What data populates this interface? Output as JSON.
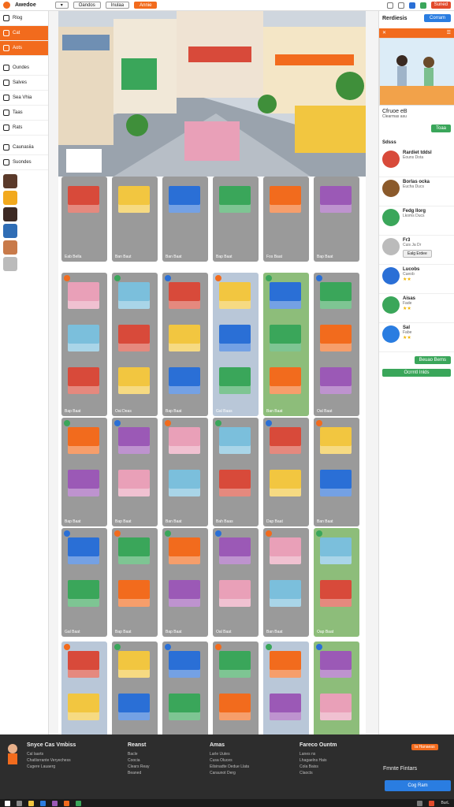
{
  "topbar": {
    "app_name": "Awedoe",
    "tabs": [
      "",
      "Oandos",
      "Inulaa",
      "Annie"
    ],
    "badge": "Suned"
  },
  "leftnav": {
    "items": [
      {
        "label": "Rlog",
        "active": false
      },
      {
        "label": "Cat",
        "active": true
      },
      {
        "label": "Aots",
        "active": true
      },
      {
        "label": "Oundes",
        "active": false
      },
      {
        "label": "Salves",
        "active": false
      },
      {
        "label": "Sea Vhia",
        "active": false
      },
      {
        "label": "Taas",
        "active": false
      },
      {
        "label": "Rats",
        "active": false
      },
      {
        "label": "Caunasiia",
        "active": false
      },
      {
        "label": "Suondes",
        "active": false
      }
    ]
  },
  "grid": {
    "rows": [
      [
        "Eab Bella",
        "Ban Baut",
        "Ban Baat",
        "Bap Baat",
        "Fos Baat",
        "Bap Baat"
      ],
      [
        "Bap Baat",
        "Oai Deas",
        "Bap Baat",
        "Gal Baas",
        "Ban Baat",
        "Oal Baat"
      ],
      [
        "Bap Baat",
        "Bap Baat",
        "Ban Baat",
        "Bah Baas",
        "Dap Baat",
        "Ban Baat"
      ],
      [
        "Gal Baat",
        "Bap Baat",
        "Bap Baat",
        "Oal Baat",
        "Ban Baat",
        "Oap Baat"
      ],
      [
        "",
        "",
        "",
        "",
        "",
        ""
      ]
    ]
  },
  "rightpanel": {
    "title": "Rerdiesis",
    "btn": "Corram",
    "promo_title": "Cfruoe eB",
    "promo_sub": "Clearmas asu",
    "promo_btn": "Toaa",
    "section": "Sdsss",
    "feed": [
      {
        "name": "Rardiet tddsl",
        "sub": "Eouns Dota",
        "pill": ""
      },
      {
        "name": "Borlas ocka",
        "sub": "Eucha Ducs",
        "pill": ""
      },
      {
        "name": "Fedg Ilorg",
        "sub": "Lkoms Ducs",
        "pill": ""
      },
      {
        "name": "Fr3",
        "sub": "Cuis Ja Dr",
        "pill": "Ealg Erdee"
      },
      {
        "name": "Lucobs",
        "sub": "Cueob",
        "stars": "★★"
      },
      {
        "name": "Aisas",
        "sub": "Fade",
        "stars": "★★"
      },
      {
        "name": "Sal",
        "sub": "Fabe",
        "stars": "★★"
      }
    ],
    "btn2": "Beuao Bems",
    "btn3": "Ocrmtl Inlds"
  },
  "footer": {
    "col1_title": "Snyce Cas Vmbiss",
    "col1_links": [
      "Cal laarts",
      "Chatlisrrante Veryechess",
      "Cugere Lauaerg"
    ],
    "col2_title": "Reanst",
    "col2_links": [
      "Bacle",
      "Coocia",
      "Clears Reay",
      "Beaned"
    ],
    "col3_title": "Amas",
    "col3_links": [
      "Larle Uutes",
      "Cusa Oluces",
      "Eilsinadte Dedue Llata",
      "Caraunot Derg"
    ],
    "col4_title": "Fareco Ountm",
    "col4_links": [
      "Lanes ns",
      "Lhagaelns Hais",
      "Cola Baiss",
      "Claocts"
    ],
    "badge": "Ia Hanaeas",
    "cta": "Fmnte Fintars",
    "btn": "Cog Ram"
  },
  "taskbar": {
    "clock": "BurL"
  },
  "colors": {
    "accent": "#f26b1d",
    "blue": "#2a7de1",
    "green": "#3aa65a"
  }
}
